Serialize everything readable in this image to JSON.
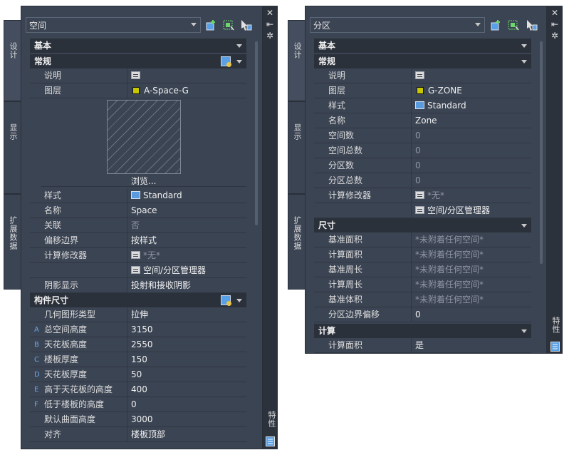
{
  "left": {
    "selector": "空间",
    "side_tabs": [
      "设计",
      "显示",
      "扩展数据"
    ],
    "palette_label": "特性",
    "sections": {
      "basic": "基本",
      "general": "常规",
      "component": "构件尺寸"
    },
    "general_rows": [
      {
        "label": "说明",
        "value": ""
      },
      {
        "label": "图层",
        "value": "A-Space-G"
      }
    ],
    "browse": "浏览...",
    "rows2": [
      {
        "label": "样式",
        "value": "Standard"
      },
      {
        "label": "名称",
        "value": "Space"
      },
      {
        "label": "关联",
        "value": "否"
      },
      {
        "label": "偏移边界",
        "value": "按样式"
      },
      {
        "label": "计算修改器",
        "value": "*无*"
      },
      {
        "label": "",
        "value": "空间/分区管理器"
      },
      {
        "label": "阴影显示",
        "value": "投射和接收阴影"
      }
    ],
    "component_rows": [
      {
        "letter": "",
        "label": "几何图形类型",
        "value": "拉伸"
      },
      {
        "letter": "A",
        "label": "总空间高度",
        "value": "3150"
      },
      {
        "letter": "B",
        "label": "天花板高度",
        "value": "2550"
      },
      {
        "letter": "C",
        "label": "楼板厚度",
        "value": "150"
      },
      {
        "letter": "D",
        "label": "天花板厚度",
        "value": "50"
      },
      {
        "letter": "E",
        "label": "高于天花板的高度",
        "value": "400"
      },
      {
        "letter": "F",
        "label": "低于楼板的高度",
        "value": "0"
      },
      {
        "letter": "",
        "label": "默认曲面高度",
        "value": "3000"
      },
      {
        "letter": "",
        "label": "对齐",
        "value": "楼板顶部"
      }
    ]
  },
  "right": {
    "selector": "分区",
    "side_tabs": [
      "设计",
      "显示",
      "扩展数据"
    ],
    "palette_label": "特性",
    "sections": {
      "basic": "基本",
      "general": "常规",
      "dimensions": "尺寸",
      "calc": "计算"
    },
    "general_rows": [
      {
        "label": "说明",
        "value": ""
      },
      {
        "label": "图层",
        "value": "G-ZONE"
      },
      {
        "label": "样式",
        "value": "Standard"
      },
      {
        "label": "名称",
        "value": "Zone"
      },
      {
        "label": "空间数",
        "value": "0"
      },
      {
        "label": "空间总数",
        "value": "0"
      },
      {
        "label": "分区数",
        "value": "0"
      },
      {
        "label": "分区总数",
        "value": "0"
      },
      {
        "label": "计算修改器",
        "value": "*无*"
      },
      {
        "label": "",
        "value": "空间/分区管理器"
      }
    ],
    "dimension_rows": [
      {
        "label": "基准面积",
        "value": "*未附着任何空间*"
      },
      {
        "label": "计算面积",
        "value": "*未附着任何空间*"
      },
      {
        "label": "基准周长",
        "value": "*未附着任何空间*"
      },
      {
        "label": "计算周长",
        "value": "*未附着任何空间*"
      },
      {
        "label": "基准体积",
        "value": "*未附着任何空间*"
      },
      {
        "label": "分区边界偏移",
        "value": "0"
      }
    ],
    "calc_rows": [
      {
        "label": "计算面积",
        "value": "是"
      }
    ]
  },
  "colors": {
    "panel": "#3b4453",
    "header": "#2b313b",
    "accent": "#5aa0e6"
  }
}
